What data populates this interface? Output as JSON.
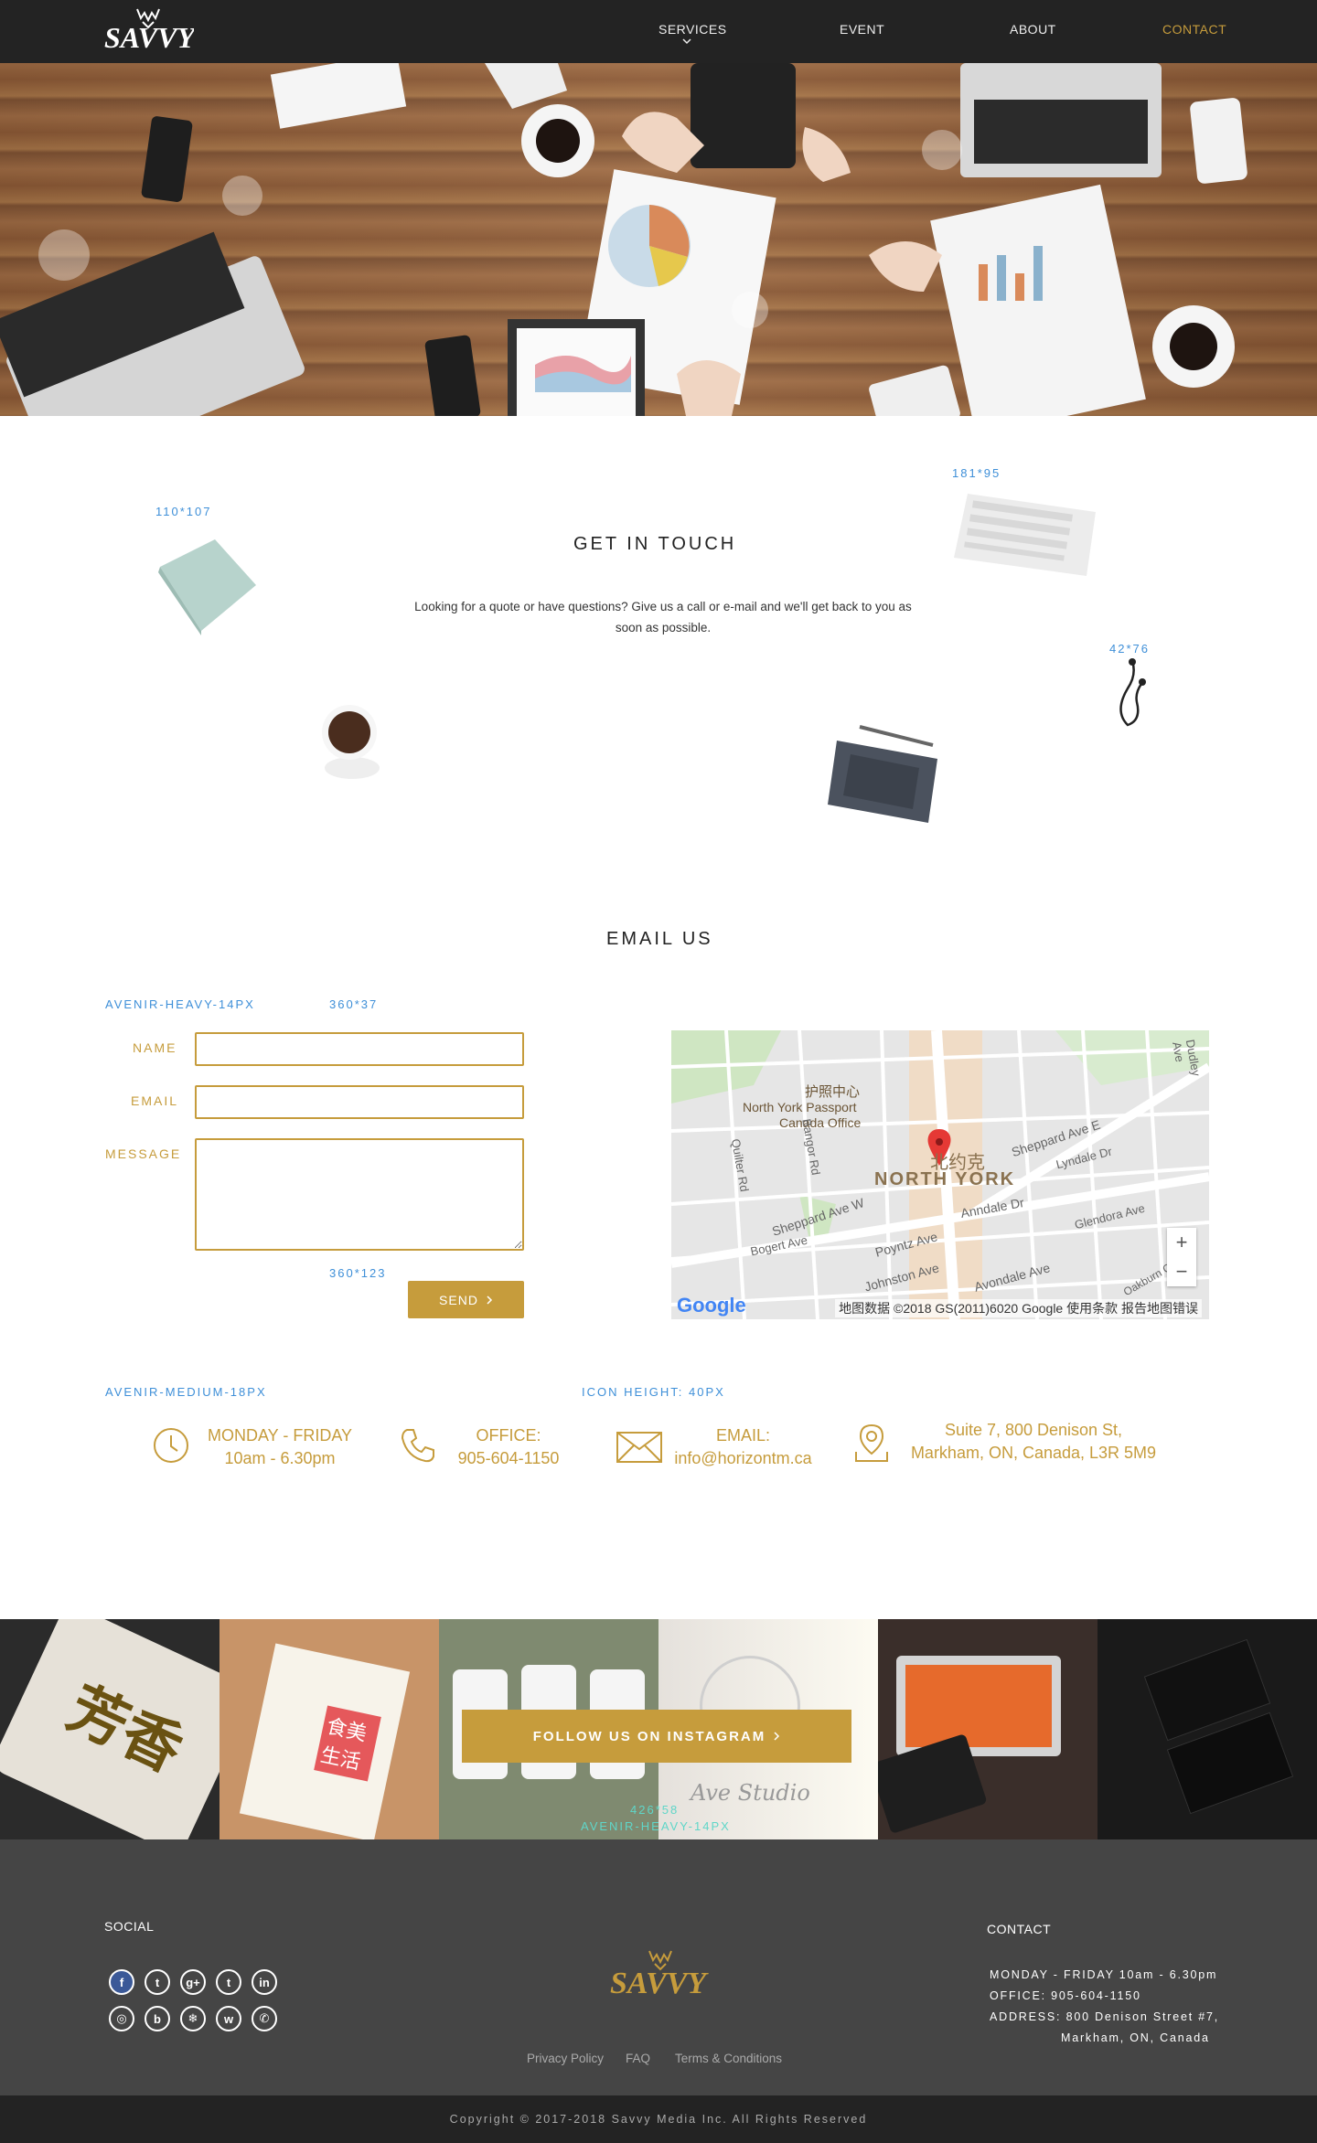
{
  "nav": {
    "items": [
      {
        "label": "SERVICES"
      },
      {
        "label": "EVENT"
      },
      {
        "label": "ABOUT"
      },
      {
        "label": "CONTACT"
      }
    ],
    "accent": "#c69c3c"
  },
  "logo": {
    "text": "SAVVY"
  },
  "annotations": {
    "item1": "110*107",
    "item2": "181*95",
    "item3": "42*76",
    "form_font": "AVENIR-HEAVY-14PX",
    "input_size": "360*37",
    "textarea_size": "360*123",
    "info_font": "AVENIR-MEDIUM-18PX",
    "icon_height": "ICON HEIGHT: 40PX",
    "follow_size": "426*58",
    "follow_font": "AVENIR-HEAVY-14PX"
  },
  "touch": {
    "title": "GET IN TOUCH",
    "intro": "Looking for a quote or have questions?  Give us a call or e-mail and we'll get back to you as soon as possible."
  },
  "email_us": {
    "title": "EMAIL US",
    "name_label": "NAME",
    "email_label": "EMAIL",
    "message_label": "MESSAGE",
    "send_label": "SEND"
  },
  "map": {
    "place_cn": "北约克",
    "place_en": "NORTH YORK",
    "poi_cn": "护照中心",
    "poi_en1": "North York Passport",
    "poi_en2": "Canada Office",
    "attribution": "地图数据 ©2018 GS(2011)6020 Google   使用条款   报告地图错误",
    "google": "Google",
    "streets": [
      "Sheppard Ave W",
      "Sheppard Ave E",
      "Poyntz Ave",
      "Johnston Ave",
      "Avondale Ave",
      "Anndale Dr",
      "Lyndale Dr",
      "Glendora Ave",
      "Bogert Ave",
      "Quilter Rd",
      "Bangor Rd",
      "Dudley Ave",
      "Oakburn Cresc"
    ]
  },
  "info": {
    "hours_title": "MONDAY - FRIDAY",
    "hours_value": "10am - 6.30pm",
    "office_title": "OFFICE:",
    "office_value": "905-604-1150",
    "email_title": "EMAIL:",
    "email_value": "info@horizontm.ca",
    "address_line1": "Suite 7, 800 Denison St,",
    "address_line2": "Markham, ON, Canada, L3R 5M9"
  },
  "instagram": {
    "follow_label": "FOLLOW US ON INSTAGRAM",
    "tile_texts": [
      "芳香",
      "食美生活",
      "",
      "Ave Studio",
      "",
      ""
    ]
  },
  "footer": {
    "social_title": "SOCIAL",
    "contact_title": "CONTACT",
    "contact_lines": [
      "MONDAY - FRIDAY 10am - 6.30pm",
      "OFFICE:  905-604-1150",
      "ADDRESS: 800 Denison Street #7,",
      "Markham, ON, Canada"
    ],
    "links": [
      "Privacy Policy",
      "FAQ",
      "Terms & Conditions"
    ],
    "social_icons": [
      "facebook-icon",
      "twitter-icon",
      "google-plus-icon",
      "tumblr-icon",
      "linkedin-icon",
      "instagram-icon",
      "bing-icon",
      "snowflake-icon",
      "weibo-icon",
      "wechat-icon"
    ],
    "social_glyphs": [
      "f",
      "t",
      "g+",
      "t",
      "in",
      "◎",
      "b",
      "❄",
      "w",
      "✆"
    ],
    "copyright": "Copyright © 2017-2018  Savvy Media Inc. All Rights Reserved"
  }
}
